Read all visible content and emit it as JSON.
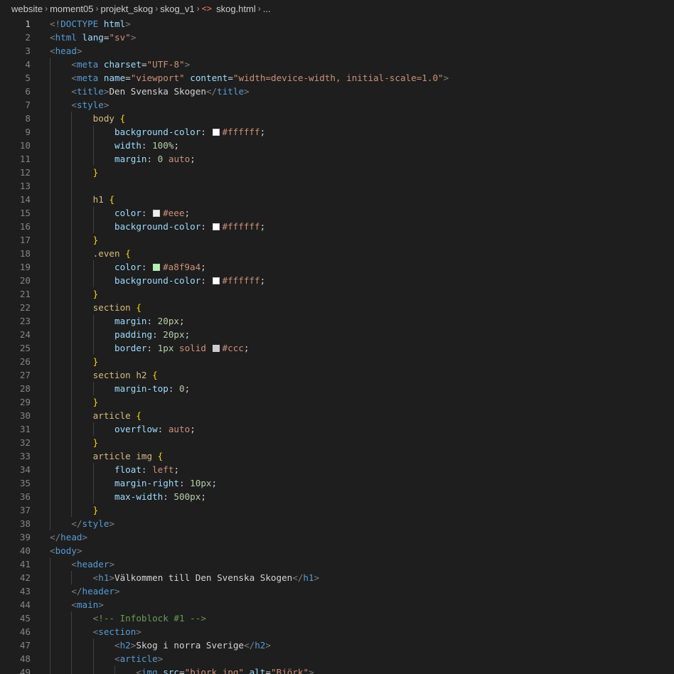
{
  "breadcrumb": {
    "items": [
      "website",
      "moment05",
      "projekt_skog",
      "skog_v1"
    ],
    "file_icon": "<>",
    "file": "skog.html",
    "ellipsis": "...",
    "separator": "›"
  },
  "editor": {
    "active_line": 1,
    "first_line_number": 1,
    "lines": [
      [
        [
          "t-bracket",
          "<!"
        ],
        [
          "t-tag",
          "DOCTYPE"
        ],
        [
          "t-plain",
          " "
        ],
        [
          "t-attr",
          "html"
        ],
        [
          "t-bracket",
          ">"
        ]
      ],
      [
        [
          "t-bracket",
          "<"
        ],
        [
          "t-tag",
          "html"
        ],
        [
          "t-plain",
          " "
        ],
        [
          "t-attr",
          "lang"
        ],
        [
          "t-plain",
          "="
        ],
        [
          "t-str",
          "\"sv\""
        ],
        [
          "t-bracket",
          ">"
        ]
      ],
      [
        [
          "t-bracket",
          "<"
        ],
        [
          "t-tag",
          "head"
        ],
        [
          "t-bracket",
          ">"
        ]
      ],
      [
        [
          "t-plain",
          "    "
        ],
        [
          "t-bracket",
          "<"
        ],
        [
          "t-tag",
          "meta"
        ],
        [
          "t-plain",
          " "
        ],
        [
          "t-attr",
          "charset"
        ],
        [
          "t-plain",
          "="
        ],
        [
          "t-str",
          "\"UTF-8\""
        ],
        [
          "t-bracket",
          ">"
        ]
      ],
      [
        [
          "t-plain",
          "    "
        ],
        [
          "t-bracket",
          "<"
        ],
        [
          "t-tag",
          "meta"
        ],
        [
          "t-plain",
          " "
        ],
        [
          "t-attr",
          "name"
        ],
        [
          "t-plain",
          "="
        ],
        [
          "t-str",
          "\"viewport\""
        ],
        [
          "t-plain",
          " "
        ],
        [
          "t-attr",
          "content"
        ],
        [
          "t-plain",
          "="
        ],
        [
          "t-str",
          "\"width=device-width, initial-scale=1.0\""
        ],
        [
          "t-bracket",
          ">"
        ]
      ],
      [
        [
          "t-plain",
          "    "
        ],
        [
          "t-bracket",
          "<"
        ],
        [
          "t-tag",
          "title"
        ],
        [
          "t-bracket",
          ">"
        ],
        [
          "t-text",
          "Den Svenska Skogen"
        ],
        [
          "t-bracket",
          "</"
        ],
        [
          "t-tag",
          "title"
        ],
        [
          "t-bracket",
          ">"
        ]
      ],
      [
        [
          "t-plain",
          "    "
        ],
        [
          "t-bracket",
          "<"
        ],
        [
          "t-tag",
          "style"
        ],
        [
          "t-bracket",
          ">"
        ]
      ],
      [
        [
          "t-plain",
          "        "
        ],
        [
          "t-sel",
          "body"
        ],
        [
          "t-plain",
          " "
        ],
        [
          "t-brace",
          "{"
        ]
      ],
      [
        [
          "t-plain",
          "            "
        ],
        [
          "t-prop",
          "background-color"
        ],
        [
          "t-plain",
          ": "
        ],
        [
          "swatch",
          "#ffffff"
        ],
        [
          "t-val",
          "#ffffff"
        ],
        [
          "t-plain",
          ";"
        ]
      ],
      [
        [
          "t-plain",
          "            "
        ],
        [
          "t-prop",
          "width"
        ],
        [
          "t-plain",
          ": "
        ],
        [
          "t-num",
          "100%"
        ],
        [
          "t-plain",
          ";"
        ]
      ],
      [
        [
          "t-plain",
          "            "
        ],
        [
          "t-prop",
          "margin"
        ],
        [
          "t-plain",
          ": "
        ],
        [
          "t-num",
          "0"
        ],
        [
          "t-plain",
          " "
        ],
        [
          "t-val",
          "auto"
        ],
        [
          "t-plain",
          ";"
        ]
      ],
      [
        [
          "t-plain",
          "        "
        ],
        [
          "t-brace",
          "}"
        ]
      ],
      [],
      [
        [
          "t-plain",
          "        "
        ],
        [
          "t-sel",
          "h1"
        ],
        [
          "t-plain",
          " "
        ],
        [
          "t-brace",
          "{"
        ]
      ],
      [
        [
          "t-plain",
          "            "
        ],
        [
          "t-prop",
          "color"
        ],
        [
          "t-plain",
          ": "
        ],
        [
          "swatch",
          "#eeeeee"
        ],
        [
          "t-val",
          "#eee"
        ],
        [
          "t-plain",
          ";"
        ]
      ],
      [
        [
          "t-plain",
          "            "
        ],
        [
          "t-prop",
          "background-color"
        ],
        [
          "t-plain",
          ": "
        ],
        [
          "swatch",
          "#ffffff"
        ],
        [
          "t-val",
          "#ffffff"
        ],
        [
          "t-plain",
          ";"
        ]
      ],
      [
        [
          "t-plain",
          "        "
        ],
        [
          "t-brace",
          "}"
        ]
      ],
      [
        [
          "t-plain",
          "        "
        ],
        [
          "t-sel",
          ".even"
        ],
        [
          "t-plain",
          " "
        ],
        [
          "t-brace",
          "{"
        ]
      ],
      [
        [
          "t-plain",
          "            "
        ],
        [
          "t-prop",
          "color"
        ],
        [
          "t-plain",
          ": "
        ],
        [
          "swatch",
          "#a8f9a4"
        ],
        [
          "t-val",
          "#a8f9a4"
        ],
        [
          "t-plain",
          ";"
        ]
      ],
      [
        [
          "t-plain",
          "            "
        ],
        [
          "t-prop",
          "background-color"
        ],
        [
          "t-plain",
          ": "
        ],
        [
          "swatch",
          "#ffffff"
        ],
        [
          "t-val",
          "#ffffff"
        ],
        [
          "t-plain",
          ";"
        ]
      ],
      [
        [
          "t-plain",
          "        "
        ],
        [
          "t-brace",
          "}"
        ]
      ],
      [
        [
          "t-plain",
          "        "
        ],
        [
          "t-sel",
          "section"
        ],
        [
          "t-plain",
          " "
        ],
        [
          "t-brace",
          "{"
        ]
      ],
      [
        [
          "t-plain",
          "            "
        ],
        [
          "t-prop",
          "margin"
        ],
        [
          "t-plain",
          ": "
        ],
        [
          "t-num",
          "20px"
        ],
        [
          "t-plain",
          ";"
        ]
      ],
      [
        [
          "t-plain",
          "            "
        ],
        [
          "t-prop",
          "padding"
        ],
        [
          "t-plain",
          ": "
        ],
        [
          "t-num",
          "20px"
        ],
        [
          "t-plain",
          ";"
        ]
      ],
      [
        [
          "t-plain",
          "            "
        ],
        [
          "t-prop",
          "border"
        ],
        [
          "t-plain",
          ": "
        ],
        [
          "t-num",
          "1px"
        ],
        [
          "t-plain",
          " "
        ],
        [
          "t-val",
          "solid"
        ],
        [
          "t-plain",
          " "
        ],
        [
          "swatch",
          "#cccccc"
        ],
        [
          "t-val",
          "#ccc"
        ],
        [
          "t-plain",
          ";"
        ]
      ],
      [
        [
          "t-plain",
          "        "
        ],
        [
          "t-brace",
          "}"
        ]
      ],
      [
        [
          "t-plain",
          "        "
        ],
        [
          "t-sel",
          "section h2"
        ],
        [
          "t-plain",
          " "
        ],
        [
          "t-brace",
          "{"
        ]
      ],
      [
        [
          "t-plain",
          "            "
        ],
        [
          "t-prop",
          "margin-top"
        ],
        [
          "t-plain",
          ": "
        ],
        [
          "t-num",
          "0"
        ],
        [
          "t-plain",
          ";"
        ]
      ],
      [
        [
          "t-plain",
          "        "
        ],
        [
          "t-brace",
          "}"
        ]
      ],
      [
        [
          "t-plain",
          "        "
        ],
        [
          "t-sel",
          "article"
        ],
        [
          "t-plain",
          " "
        ],
        [
          "t-brace",
          "{"
        ]
      ],
      [
        [
          "t-plain",
          "            "
        ],
        [
          "t-prop",
          "overflow"
        ],
        [
          "t-plain",
          ": "
        ],
        [
          "t-val",
          "auto"
        ],
        [
          "t-plain",
          ";"
        ]
      ],
      [
        [
          "t-plain",
          "        "
        ],
        [
          "t-brace",
          "}"
        ]
      ],
      [
        [
          "t-plain",
          "        "
        ],
        [
          "t-sel",
          "article img"
        ],
        [
          "t-plain",
          " "
        ],
        [
          "t-brace",
          "{"
        ]
      ],
      [
        [
          "t-plain",
          "            "
        ],
        [
          "t-prop",
          "float"
        ],
        [
          "t-plain",
          ": "
        ],
        [
          "t-val",
          "left"
        ],
        [
          "t-plain",
          ";"
        ]
      ],
      [
        [
          "t-plain",
          "            "
        ],
        [
          "t-prop",
          "margin-right"
        ],
        [
          "t-plain",
          ": "
        ],
        [
          "t-num",
          "10px"
        ],
        [
          "t-plain",
          ";"
        ]
      ],
      [
        [
          "t-plain",
          "            "
        ],
        [
          "t-prop",
          "max-width"
        ],
        [
          "t-plain",
          ": "
        ],
        [
          "t-num",
          "500px"
        ],
        [
          "t-plain",
          ";"
        ]
      ],
      [
        [
          "t-plain",
          "        "
        ],
        [
          "t-brace",
          "}"
        ]
      ],
      [
        [
          "t-plain",
          "    "
        ],
        [
          "t-bracket",
          "</"
        ],
        [
          "t-tag",
          "style"
        ],
        [
          "t-bracket",
          ">"
        ]
      ],
      [
        [
          "t-bracket",
          "</"
        ],
        [
          "t-tag",
          "head"
        ],
        [
          "t-bracket",
          ">"
        ]
      ],
      [
        [
          "t-bracket",
          "<"
        ],
        [
          "t-tag",
          "body"
        ],
        [
          "t-bracket",
          ">"
        ]
      ],
      [
        [
          "t-plain",
          "    "
        ],
        [
          "t-bracket",
          "<"
        ],
        [
          "t-tag",
          "header"
        ],
        [
          "t-bracket",
          ">"
        ]
      ],
      [
        [
          "t-plain",
          "        "
        ],
        [
          "t-bracket",
          "<"
        ],
        [
          "t-tag",
          "h1"
        ],
        [
          "t-bracket",
          ">"
        ],
        [
          "t-text",
          "Välkommen till Den Svenska Skogen"
        ],
        [
          "t-bracket",
          "</"
        ],
        [
          "t-tag",
          "h1"
        ],
        [
          "t-bracket",
          ">"
        ]
      ],
      [
        [
          "t-plain",
          "    "
        ],
        [
          "t-bracket",
          "</"
        ],
        [
          "t-tag",
          "header"
        ],
        [
          "t-bracket",
          ">"
        ]
      ],
      [
        [
          "t-plain",
          "    "
        ],
        [
          "t-bracket",
          "<"
        ],
        [
          "t-tag",
          "main"
        ],
        [
          "t-bracket",
          ">"
        ]
      ],
      [
        [
          "t-plain",
          "        "
        ],
        [
          "t-com",
          "<!-- Infoblock #1 -->"
        ]
      ],
      [
        [
          "t-plain",
          "        "
        ],
        [
          "t-bracket",
          "<"
        ],
        [
          "t-tag",
          "section"
        ],
        [
          "t-bracket",
          ">"
        ]
      ],
      [
        [
          "t-plain",
          "            "
        ],
        [
          "t-bracket",
          "<"
        ],
        [
          "t-tag",
          "h2"
        ],
        [
          "t-bracket",
          ">"
        ],
        [
          "t-text",
          "Skog i norra Sverige"
        ],
        [
          "t-bracket",
          "</"
        ],
        [
          "t-tag",
          "h2"
        ],
        [
          "t-bracket",
          ">"
        ]
      ],
      [
        [
          "t-plain",
          "            "
        ],
        [
          "t-bracket",
          "<"
        ],
        [
          "t-tag",
          "article"
        ],
        [
          "t-bracket",
          ">"
        ]
      ],
      [
        [
          "t-plain",
          "                "
        ],
        [
          "t-bracket",
          "<"
        ],
        [
          "t-tag",
          "img"
        ],
        [
          "t-plain",
          " "
        ],
        [
          "t-attr",
          "src"
        ],
        [
          "t-plain",
          "="
        ],
        [
          "t-str",
          "\"bjork.jpg\""
        ],
        [
          "t-plain",
          " "
        ],
        [
          "t-attr",
          "alt"
        ],
        [
          "t-plain",
          "="
        ],
        [
          "t-str",
          "\"Björk\""
        ],
        [
          "t-bracket",
          ">"
        ]
      ]
    ]
  }
}
